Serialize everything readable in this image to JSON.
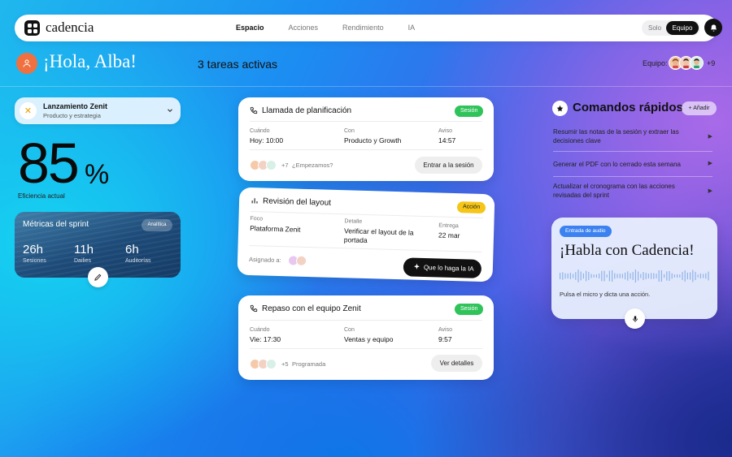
{
  "app": {
    "brand": "cadencia"
  },
  "nav": {
    "items": [
      {
        "label": "Espacio",
        "active": true
      },
      {
        "label": "Acciones",
        "active": false
      },
      {
        "label": "Rendimiento",
        "active": false
      },
      {
        "label": "IA",
        "active": false
      }
    ],
    "mode_solo": "Solo",
    "mode_equipo": "Equipo",
    "selected_mode": "Equipo"
  },
  "greeting": {
    "text": "¡Hola, Alba!",
    "tasks": "3 tareas activas",
    "team_label": "Equipo:",
    "team_extra": "+9"
  },
  "project": {
    "name": "Lanzamiento Zenit",
    "subtitle": "Producto y estrategia"
  },
  "efficiency": {
    "value": "85",
    "unit": "%",
    "label": "Eficiencia actual"
  },
  "metrics": {
    "title": "Métricas del sprint",
    "tag": "Analítica",
    "stats": [
      {
        "value": "26h",
        "label": "Sesiones"
      },
      {
        "value": "11h",
        "label": "Dailies"
      },
      {
        "value": "6h",
        "label": "Auditorías"
      }
    ]
  },
  "cards": [
    {
      "title": "Llamada de planificación",
      "badge": "Sesión",
      "fields": [
        {
          "label": "Cuándo",
          "value": "Hoy: 10:00"
        },
        {
          "label": "Con",
          "value": "Producto y Growth"
        },
        {
          "label": "Aviso",
          "value": "14:57"
        }
      ],
      "extra": "+7",
      "note": "¿Empezamos?",
      "action": "Entrar a la sesión"
    },
    {
      "title": "Revisión del layout",
      "badge": "Acción",
      "fields": [
        {
          "label": "Foco",
          "value": "Plataforma Zenit"
        },
        {
          "label": "Detalle",
          "value": "Verificar el layout de la portada"
        },
        {
          "label": "Entrega",
          "value": "22 mar"
        }
      ],
      "assigned_label": "Asignado a:",
      "action": "Que lo haga la IA"
    },
    {
      "title": "Repaso con el equipo Zenit",
      "badge": "Sesión",
      "fields": [
        {
          "label": "Cuándo",
          "value": "Vie: 17:30"
        },
        {
          "label": "Con",
          "value": "Ventas y equipo"
        },
        {
          "label": "Aviso",
          "value": "9:57"
        }
      ],
      "extra": "+5",
      "note": "Programada",
      "action": "Ver detalles"
    }
  ],
  "commands": {
    "title": "Comandos rápidos",
    "add": "+ Añadir",
    "items": [
      "Resumir las notas de la sesión y extraer las decisiones clave",
      "Generar el PDF con lo cerrado esta semana",
      "Actualizar el cronograma con las acciones revisadas del sprint"
    ]
  },
  "voice": {
    "tag": "Entrada de audio",
    "title": "¡Habla con Cadencia!",
    "hint": "Pulsa el micro y dicta una acción."
  },
  "colors": {
    "accent_green": "#2fc35a",
    "accent_yellow": "#f5c518",
    "accent_blue": "#3b82f0",
    "avatar_orange": "#f07040"
  }
}
